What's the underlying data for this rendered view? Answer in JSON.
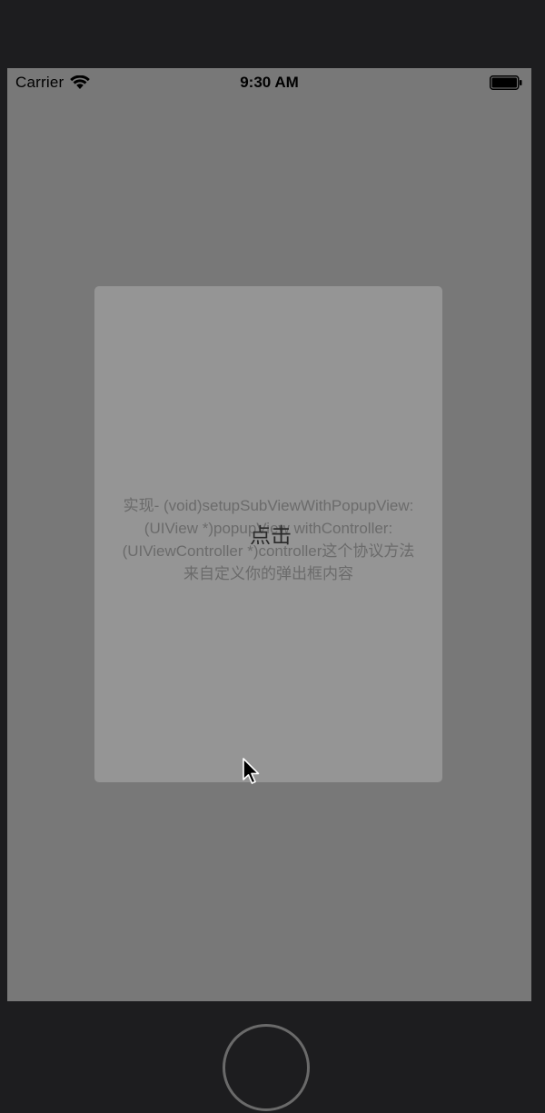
{
  "status_bar": {
    "carrier": "Carrier",
    "time": "9:30 AM",
    "wifi_icon": "wifi-icon",
    "battery_icon": "battery-icon"
  },
  "popup": {
    "description_lines": [
      "实现- (void)setupSubViewWithPopupView:",
      "(UIView *)popupView withController:",
      "(UIViewController *)controller这个协议方法",
      "来自定义你的弹出框内容"
    ],
    "button_label": "点击"
  },
  "colors": {
    "device_frame": "#1d1d1f",
    "screen_dim_overlay": "#787878",
    "popup_background": "#959595",
    "description_text": "#6b6b6b",
    "button_text": "#2a2a2a"
  }
}
